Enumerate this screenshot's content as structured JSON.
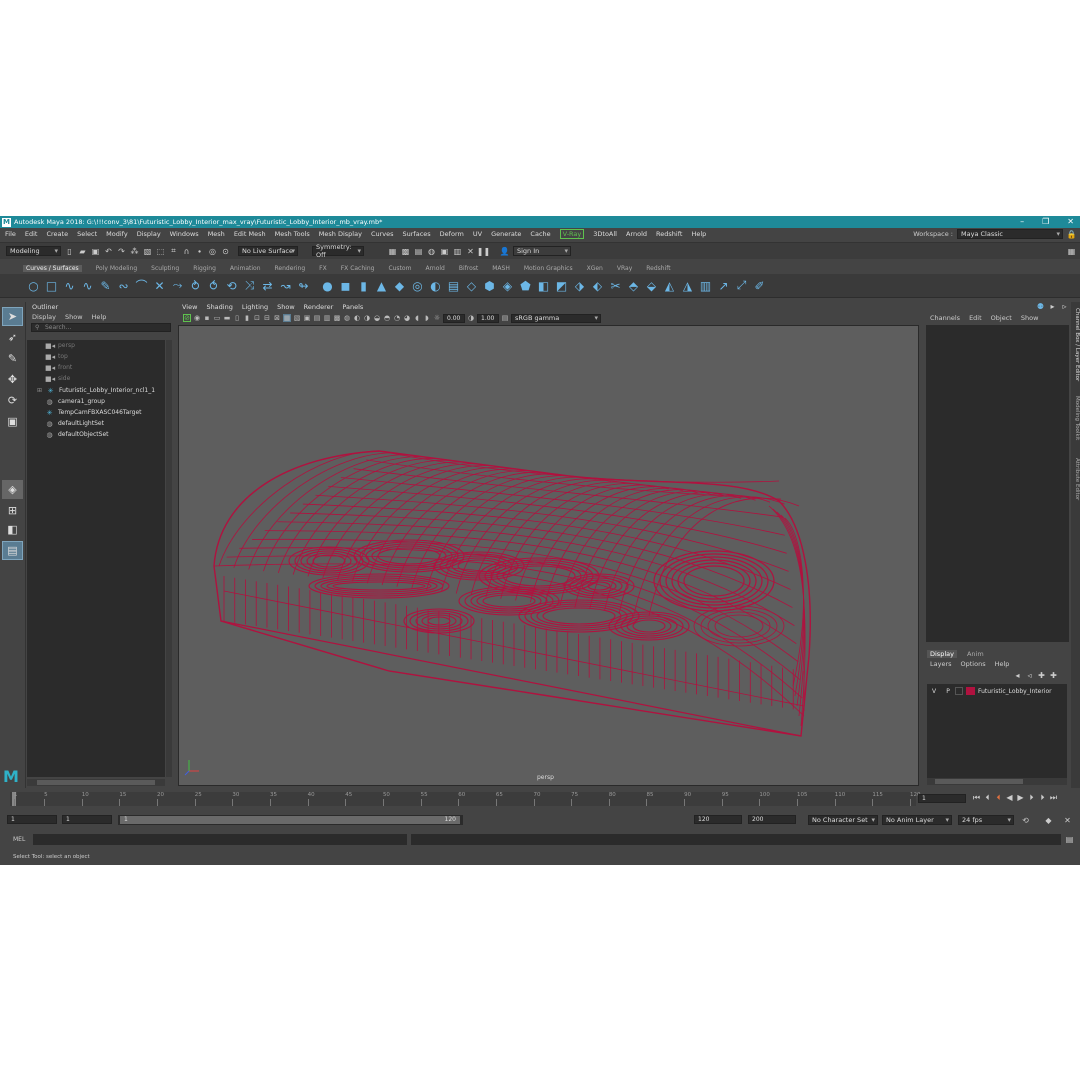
{
  "window": {
    "title": "Autodesk Maya 2018: G:\\!!!conv_3\\81\\Futuristic_Lobby_Interior_max_vray\\Futuristic_Lobby_Interior_mb_vray.mb*",
    "logo": "M"
  },
  "menu": {
    "items": [
      "File",
      "Edit",
      "Create",
      "Select",
      "Modify",
      "Display",
      "Windows",
      "Mesh",
      "Edit Mesh",
      "Mesh Tools",
      "Mesh Display",
      "Curves",
      "Surfaces",
      "Deform",
      "UV",
      "Generate",
      "Cache",
      "V-Ray",
      "3DtoAll",
      "Arnold",
      "Redshift",
      "Help"
    ],
    "workspace_label": "Workspace :",
    "workspace_value": "Maya Classic"
  },
  "status": {
    "mode": "Modeling",
    "live_surface": "No Live Surface",
    "symmetry": "Symmetry: Off",
    "sign_in": "Sign In"
  },
  "shelf": {
    "tabs": [
      "Curves / Surfaces",
      "Poly Modeling",
      "Sculpting",
      "Rigging",
      "Animation",
      "Rendering",
      "FX",
      "FX Caching",
      "Custom",
      "Arnold",
      "Bifrost",
      "MASH",
      "Motion Graphics",
      "XGen",
      "VRay",
      "Redshift"
    ],
    "active_tab": "Curves / Surfaces"
  },
  "outliner": {
    "title": "Outliner",
    "menu": [
      "Display",
      "Show",
      "Help"
    ],
    "search_placeholder": "Search...",
    "items": [
      {
        "label": "persp",
        "dim": true
      },
      {
        "label": "top",
        "dim": true
      },
      {
        "label": "front",
        "dim": true
      },
      {
        "label": "side",
        "dim": true
      },
      {
        "label": "Futuristic_Lobby_Interior_ncl1_1",
        "dim": false
      },
      {
        "label": "camera1_group",
        "dim": false
      },
      {
        "label": "TempCamFBXASC046Target",
        "dim": false
      },
      {
        "label": "defaultLightSet",
        "dim": false
      },
      {
        "label": "defaultObjectSet",
        "dim": false
      }
    ]
  },
  "viewport": {
    "menu": [
      "View",
      "Shading",
      "Lighting",
      "Show",
      "Renderer",
      "Panels"
    ],
    "exposure": "0.00",
    "gamma": "1.00",
    "color_space": "sRGB gamma",
    "camera_label": "persp",
    "wire_color": "#b0123f",
    "bg_color": "#5e5e5e"
  },
  "channel_box": {
    "menu": [
      "Channels",
      "Edit",
      "Object",
      "Show"
    ],
    "layer_tabs": [
      "Display",
      "Anim"
    ],
    "layer_menu": [
      "Layers",
      "Options",
      "Help"
    ],
    "layer": {
      "v": "V",
      "p": "P",
      "name": "Futuristic_Lobby_Interior",
      "color": "#b0123f"
    }
  },
  "side_tabs": [
    "Channel Box / Layer Editor",
    "Modeling Toolkit",
    "Attribute Editor"
  ],
  "timeline": {
    "ticks": [
      "1",
      "5",
      "10",
      "15",
      "20",
      "25",
      "30",
      "35",
      "40",
      "45",
      "50",
      "55",
      "60",
      "65",
      "70",
      "75",
      "80",
      "85",
      "90",
      "95",
      "100",
      "105",
      "110",
      "115",
      "120"
    ],
    "current_frame": "1"
  },
  "range": {
    "start": "1",
    "start2": "1",
    "slider_start": "1",
    "slider_end": "120",
    "end": "120",
    "end2": "200",
    "character_set": "No Character Set",
    "anim_layer": "No Anim Layer",
    "fps": "24 fps"
  },
  "command": {
    "label": "MEL"
  },
  "help": {
    "text": "Select Tool: select an object"
  }
}
